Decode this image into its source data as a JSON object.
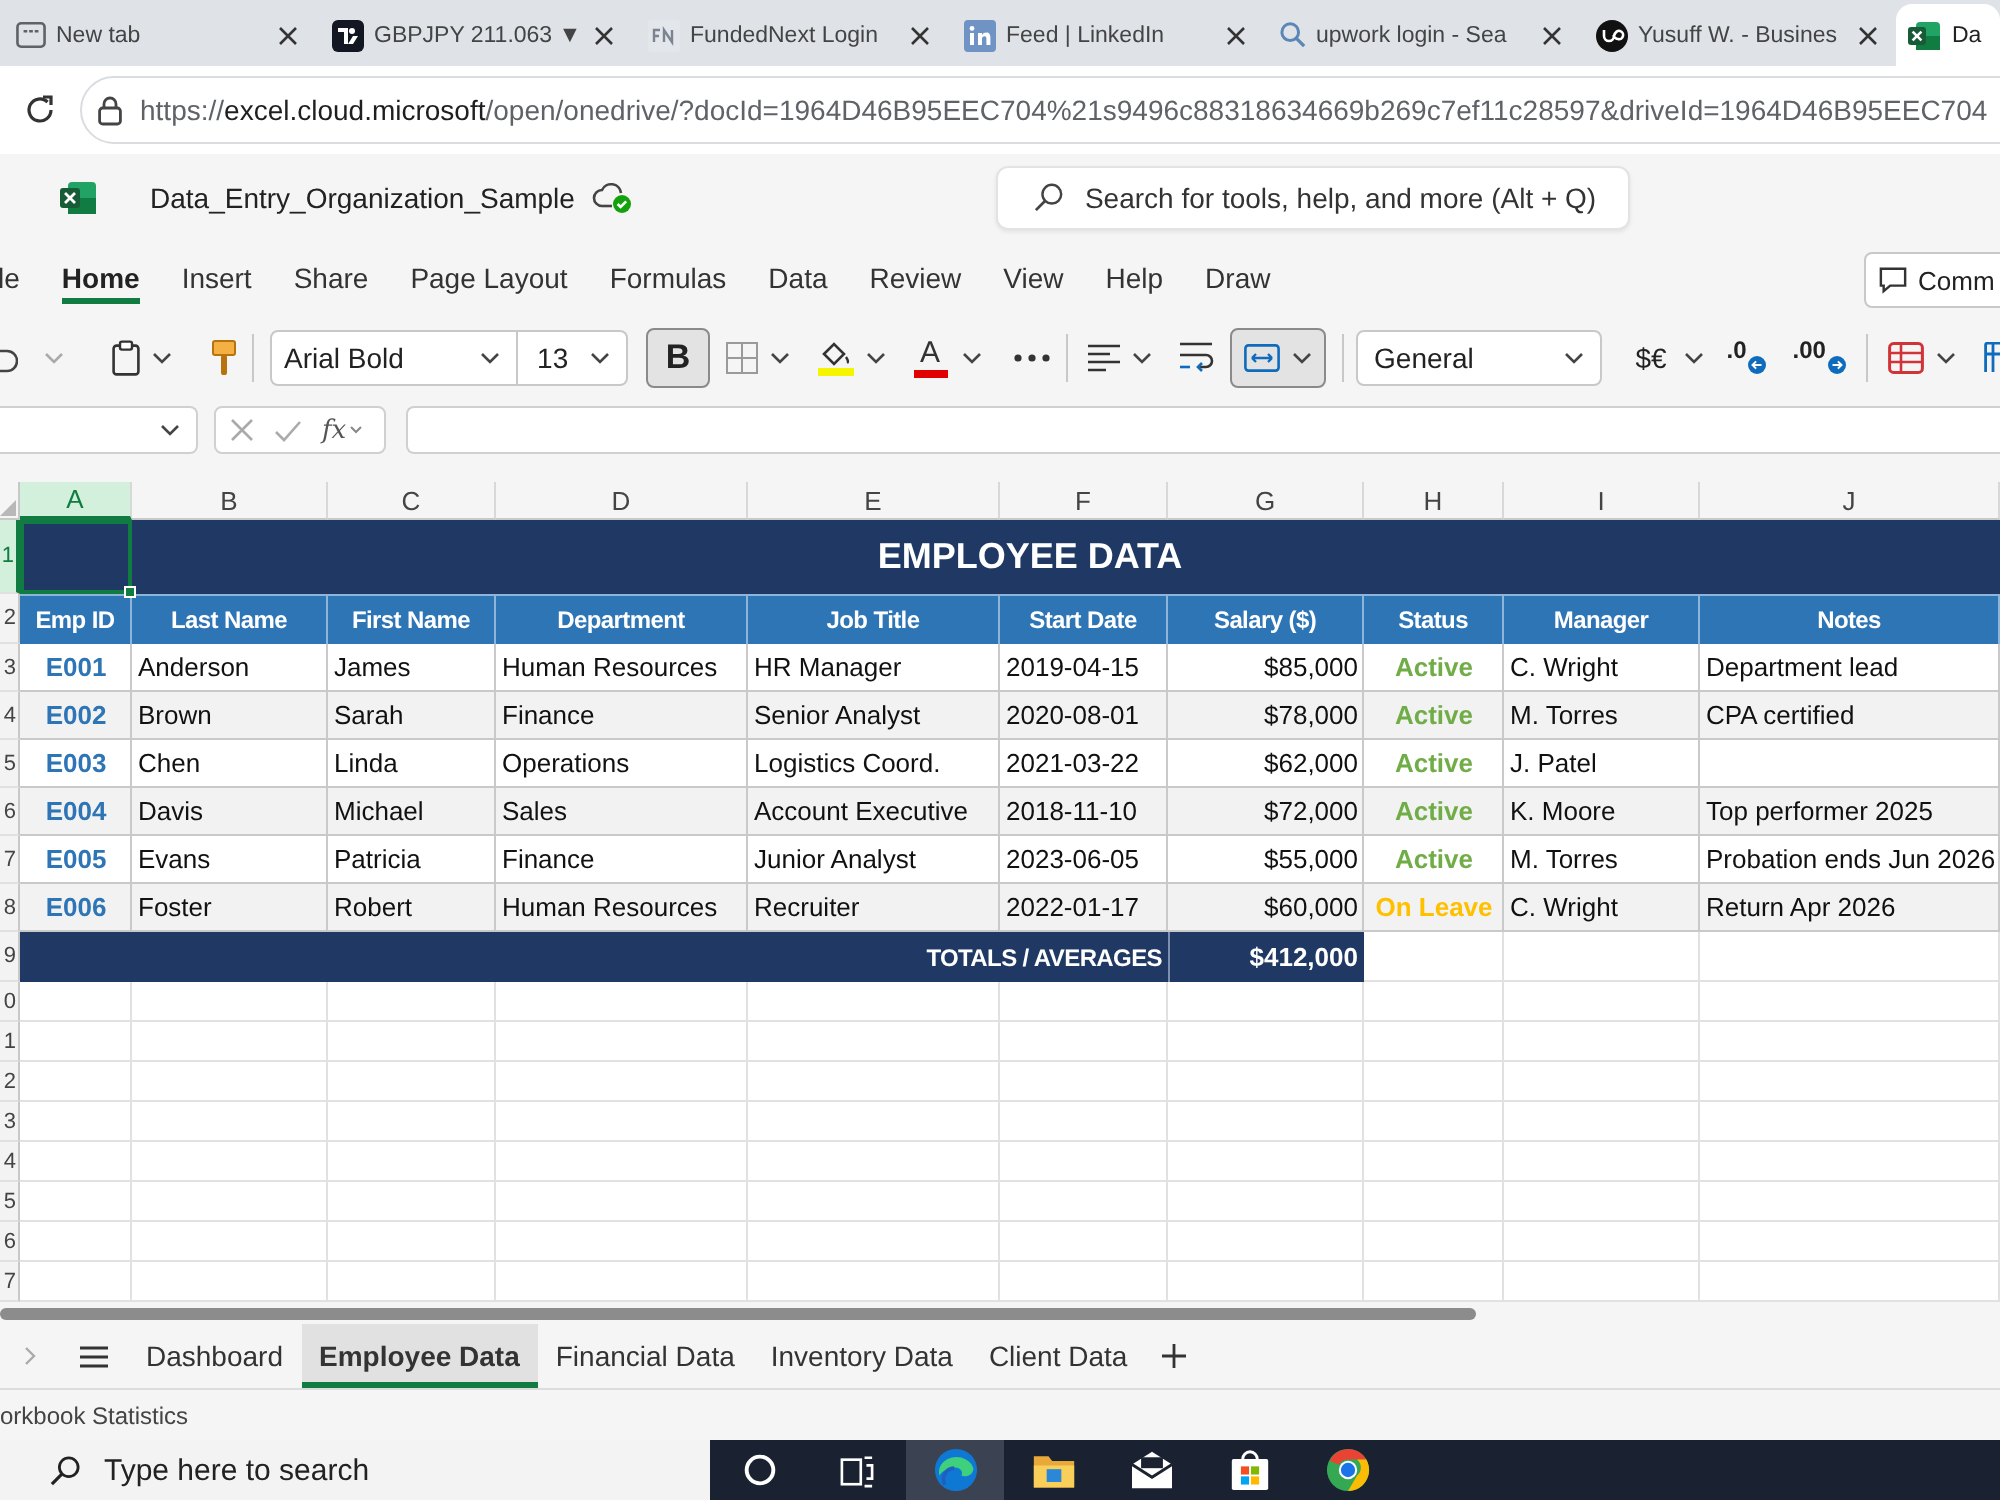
{
  "browser": {
    "tabs": [
      {
        "kind": "new_tab",
        "title": "New tab",
        "selected": false
      },
      {
        "kind": "site_dark",
        "title": "GBPJPY 211.063 ▼",
        "selected": false
      },
      {
        "kind": "site_gray",
        "title": "FundedNext Login",
        "selected": false
      },
      {
        "kind": "site_blue",
        "title": "Feed | LinkedIn",
        "selected": false
      },
      {
        "kind": "search",
        "title": "upwork login - Sea",
        "selected": false
      },
      {
        "kind": "site_round",
        "title": "Yusuff W. - Busines",
        "selected": false
      },
      {
        "kind": "spreadsheet",
        "title": "Da",
        "selected": true
      }
    ],
    "url": {
      "scheme": "https://",
      "host": "excel.cloud.microsoft",
      "path": "/open/onedrive/?docId=1964D46B95EEC704%21s9496c88318634669b269c7ef11c28597&driveId=1964D46B95EEC704"
    }
  },
  "excel": {
    "file_name": "Data_Entry_Organization_Sample",
    "search_placeholder": "Search for tools, help, and more (Alt + Q)"
  },
  "ribbon_tabs": [
    {
      "label": "le",
      "selected": false
    },
    {
      "label": "Home",
      "selected": true
    },
    {
      "label": "Insert",
      "selected": false
    },
    {
      "label": "Share",
      "selected": false
    },
    {
      "label": "Page Layout",
      "selected": false
    },
    {
      "label": "Formulas",
      "selected": false
    },
    {
      "label": "Data",
      "selected": false
    },
    {
      "label": "Review",
      "selected": false
    },
    {
      "label": "View",
      "selected": false
    },
    {
      "label": "Help",
      "selected": false
    },
    {
      "label": "Draw",
      "selected": false
    }
  ],
  "comments_button": "Comm",
  "toolbar": {
    "font_name": "Arial Bold",
    "font_size": "13",
    "bold_label": "B",
    "bold_on": true,
    "font_color_label": "A",
    "merge_on": true,
    "number_format": "General",
    "currency": "$€",
    "decimals": [
      ".0",
      ".00"
    ]
  },
  "formula_bar": {
    "function_label": "fx"
  },
  "sheet": {
    "columns": [
      {
        "letter": "A",
        "selected": true
      },
      {
        "letter": "B",
        "selected": false
      },
      {
        "letter": "C",
        "selected": false
      },
      {
        "letter": "D",
        "selected": false
      },
      {
        "letter": "E",
        "selected": false
      },
      {
        "letter": "F",
        "selected": false
      },
      {
        "letter": "G",
        "selected": false
      },
      {
        "letter": "H",
        "selected": false
      },
      {
        "letter": "I",
        "selected": false
      },
      {
        "letter": "J",
        "selected": false
      }
    ],
    "row_headers": [
      {
        "label": "1",
        "selected": true
      },
      {
        "label": "2",
        "selected": false
      },
      {
        "label": "3",
        "selected": false
      },
      {
        "label": "4",
        "selected": false
      },
      {
        "label": "5",
        "selected": false
      },
      {
        "label": "6",
        "selected": false
      },
      {
        "label": "7",
        "selected": false
      },
      {
        "label": "8",
        "selected": false
      },
      {
        "label": "9",
        "selected": false
      },
      {
        "label": "0",
        "selected": false
      },
      {
        "label": "1",
        "selected": false
      },
      {
        "label": "2",
        "selected": false
      },
      {
        "label": "3",
        "selected": false
      },
      {
        "label": "4",
        "selected": false
      },
      {
        "label": "5",
        "selected": false
      },
      {
        "label": "6",
        "selected": false
      },
      {
        "label": "7",
        "selected": false
      }
    ],
    "title": "EMPLOYEE DATA",
    "headers": [
      "Emp ID",
      "Last Name",
      "First Name",
      "Department",
      "Job Title",
      "Start Date",
      "Salary ($)",
      "Status",
      "Manager",
      "Notes"
    ],
    "rows": [
      {
        "emp_id": "E001",
        "last_name": "Anderson",
        "first_name": "James",
        "department": "Human Resources",
        "job_title": "HR Manager",
        "start_date": "2019-04-15",
        "salary": "$85,000",
        "status": {
          "text": "Active",
          "color": "#70ad47"
        },
        "manager": "C. Wright",
        "notes": "Department lead"
      },
      {
        "emp_id": "E002",
        "last_name": "Brown",
        "first_name": "Sarah",
        "department": "Finance",
        "job_title": "Senior Analyst",
        "start_date": "2020-08-01",
        "salary": "$78,000",
        "status": {
          "text": "Active",
          "color": "#70ad47"
        },
        "manager": "M. Torres",
        "notes": "CPA certified"
      },
      {
        "emp_id": "E003",
        "last_name": "Chen",
        "first_name": "Linda",
        "department": "Operations",
        "job_title": "Logistics Coord.",
        "start_date": "2021-03-22",
        "salary": "$62,000",
        "status": {
          "text": "Active",
          "color": "#70ad47"
        },
        "manager": "J. Patel"
      },
      {
        "emp_id": "E004",
        "last_name": "Davis",
        "first_name": "Michael",
        "department": "Sales",
        "job_title": "Account Executive",
        "start_date": "2018-11-10",
        "salary": "$72,000",
        "status": {
          "text": "Active",
          "color": "#70ad47"
        },
        "manager": "K. Moore",
        "notes": "Top performer 2025"
      },
      {
        "emp_id": "E005",
        "last_name": "Evans",
        "first_name": "Patricia",
        "department": "Finance",
        "job_title": "Junior Analyst",
        "start_date": "2023-06-05",
        "salary": "$55,000",
        "status": {
          "text": "Active",
          "color": "#70ad47"
        },
        "manager": "M. Torres",
        "notes": "Probation ends Jun 2026"
      },
      {
        "emp_id": "E006",
        "last_name": "Foster",
        "first_name": "Robert",
        "department": "Human Resources",
        "job_title": "Recruiter",
        "start_date": "2022-01-17",
        "salary": "$60,000",
        "status": {
          "text": "On Leave",
          "color": "#ffc000"
        },
        "manager": "C. Wright",
        "notes": "Return Apr 2026"
      }
    ],
    "totals_label": "TOTALS / AVERAGES",
    "totals_value": "$412,000"
  },
  "sheet_tabs": [
    {
      "label": "Dashboard",
      "selected": false
    },
    {
      "label": "Employee Data",
      "selected": true
    },
    {
      "label": "Financial Data",
      "selected": false
    },
    {
      "label": "Inventory Data",
      "selected": false
    },
    {
      "label": "Client Data",
      "selected": false
    }
  ],
  "status_bar": "orkbook Statistics",
  "taskbar": {
    "search_placeholder": "Type here to search",
    "apps": [
      {
        "kind": "cortana",
        "selected": false
      },
      {
        "kind": "task_view",
        "selected": false
      },
      {
        "kind": "edge",
        "selected": true
      },
      {
        "kind": "explorer",
        "selected": false
      },
      {
        "kind": "mail",
        "selected": false
      },
      {
        "kind": "store",
        "selected": false
      },
      {
        "kind": "chrome",
        "selected": false
      }
    ]
  }
}
